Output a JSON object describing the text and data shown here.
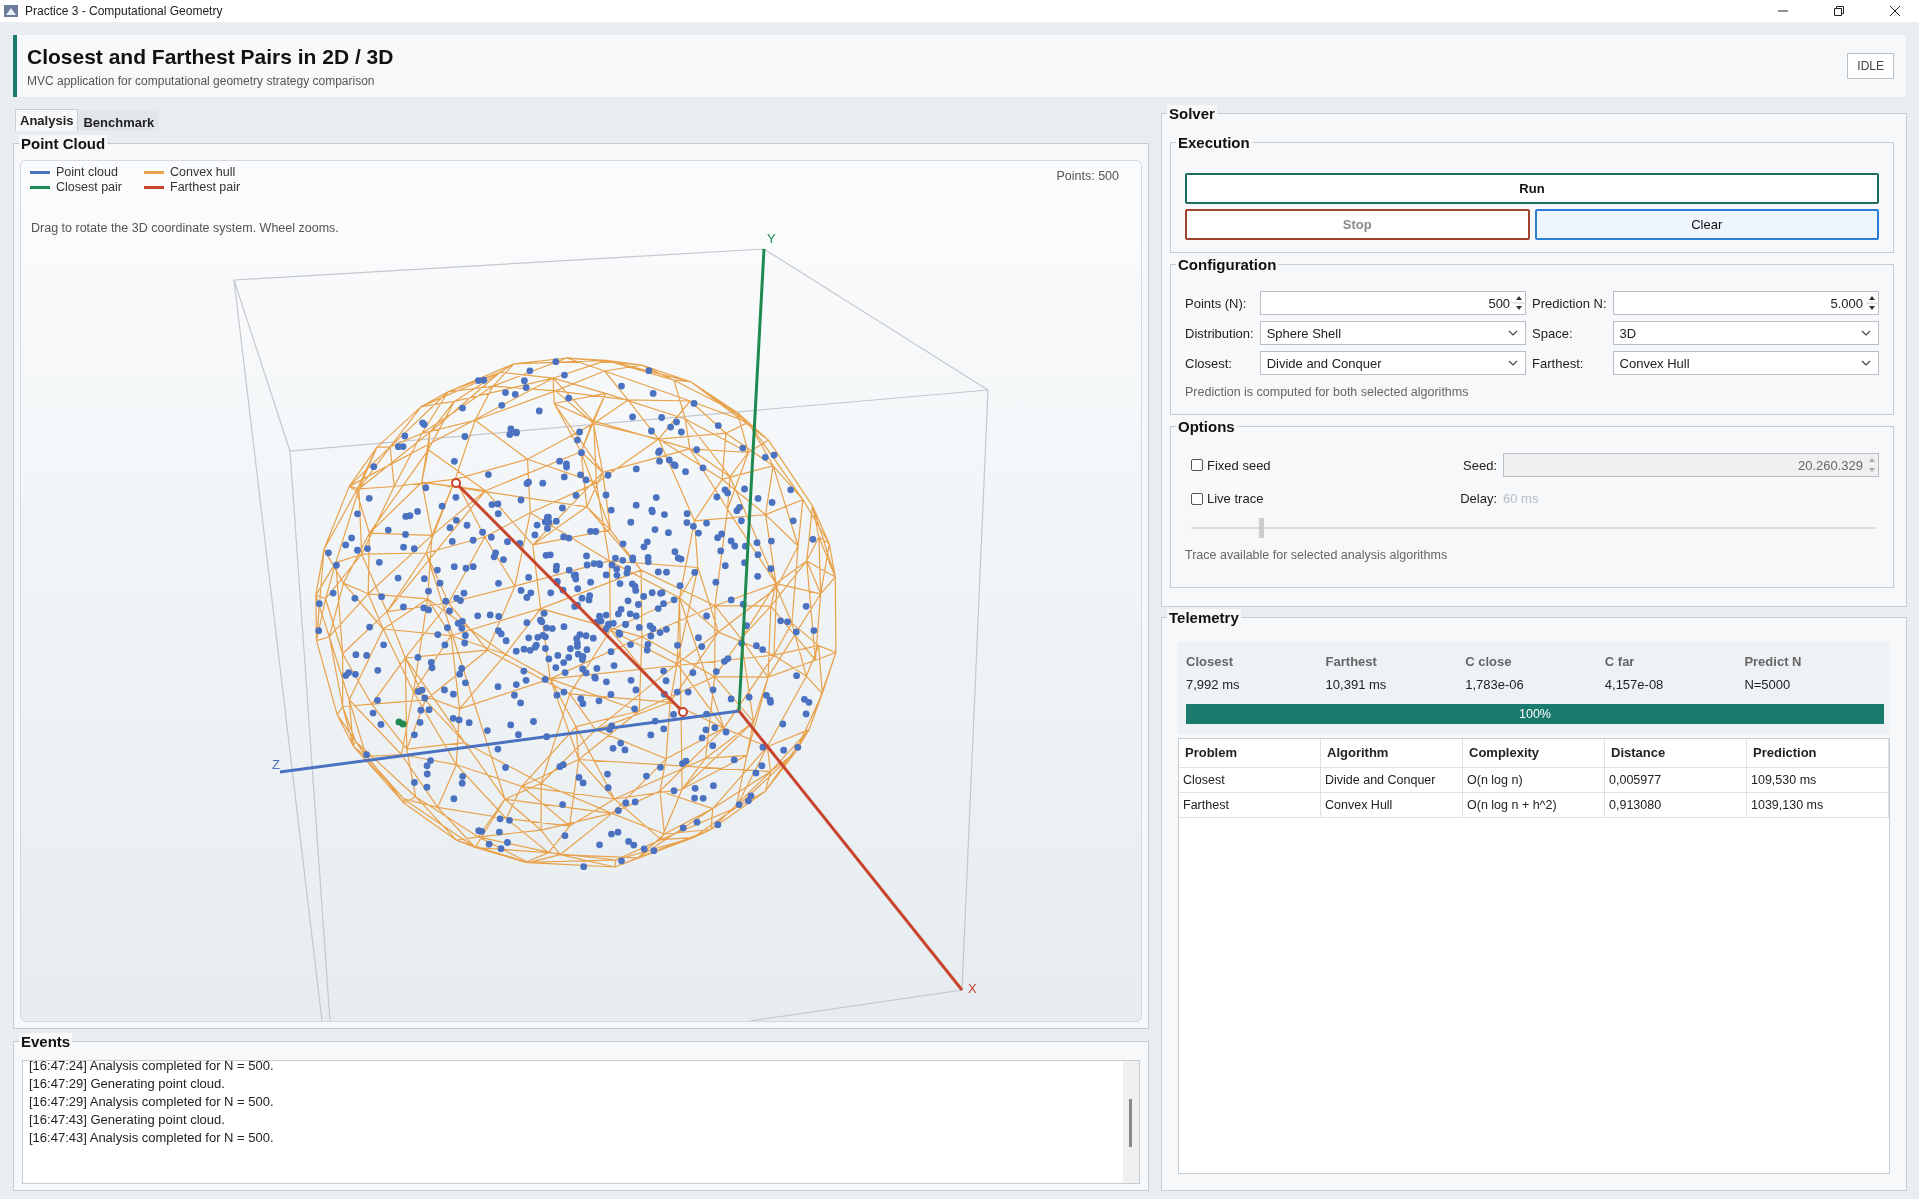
{
  "window": {
    "title": "Practice 3 - Computational Geometry"
  },
  "header": {
    "title": "Closest and Farthest Pairs in 2D / 3D",
    "subtitle": "MVC application for computational geometry strategy comparison",
    "status": "IDLE"
  },
  "tabs": [
    {
      "label": "Analysis",
      "selected": true
    },
    {
      "label": "Benchmark",
      "selected": false
    }
  ],
  "point_cloud": {
    "title": "Point Cloud",
    "count": "Points: 500",
    "hint": "Drag to rotate the 3D coordinate system. Wheel zooms.",
    "legend": [
      {
        "label": "Point cloud",
        "color": "#4a72c0"
      },
      {
        "label": "Convex hull",
        "color": "#e8a24c"
      },
      {
        "label": "Closest pair",
        "color": "#1e8a50"
      },
      {
        "label": "Farthest pair",
        "color": "#c8442c"
      }
    ],
    "axes": [
      {
        "label": "Y",
        "kind": "y"
      },
      {
        "label": "Z",
        "kind": "z"
      },
      {
        "label": "X",
        "kind": "x"
      }
    ]
  },
  "events": {
    "title": "Events",
    "lines": [
      "[16:47:24] Analysis completed for N = 500.",
      "[16:47:29] Generating point cloud.",
      "[16:47:29] Analysis completed for N = 500.",
      "[16:47:43] Generating point cloud.",
      "[16:47:43] Analysis completed for N = 500."
    ]
  },
  "solver": {
    "title": "Solver",
    "execution": {
      "title": "Execution",
      "buttons": [
        {
          "label": "Run",
          "kind": "run",
          "disabled": false
        },
        {
          "label": "Stop",
          "kind": "stop",
          "disabled": true
        },
        {
          "label": "Clear",
          "kind": "clear",
          "disabled": false
        }
      ]
    },
    "configuration": {
      "title": "Configuration",
      "note": "Prediction is computed for both selected algorithms",
      "fields": [
        {
          "label": "Points (N):",
          "value": "500",
          "kind": "spinner"
        },
        {
          "label": "Prediction N:",
          "value": "5.000",
          "kind": "spinner"
        },
        {
          "label": "Distribution:",
          "value": "Sphere Shell",
          "kind": "select"
        },
        {
          "label": "Space:",
          "value": "3D",
          "kind": "select"
        },
        {
          "label": "Closest:",
          "value": "Divide and Conquer",
          "kind": "select"
        },
        {
          "label": "Farthest:",
          "value": "Convex Hull",
          "kind": "select"
        }
      ]
    },
    "options": {
      "title": "Options",
      "fixed_seed": {
        "label": "Fixed seed",
        "checked": false
      },
      "seed": {
        "label": "Seed:",
        "value": "20.260.329",
        "disabled": true
      },
      "live_trace": {
        "label": "Live trace",
        "checked": false
      },
      "delay": {
        "label": "Delay:",
        "value": "60 ms",
        "disabled": true
      },
      "slider": {
        "level": 0.1,
        "disabled": true
      },
      "note": "Trace available for selected analysis algorithms"
    }
  },
  "telemetry": {
    "title": "Telemetry",
    "stats": [
      {
        "label": "Closest",
        "value": "7,992 ms"
      },
      {
        "label": "Farthest",
        "value": "10,391 ms"
      },
      {
        "label": "C close",
        "value": "1,783e-06"
      },
      {
        "label": "C far",
        "value": "4,157e-08"
      },
      {
        "label": "Predict N",
        "value": "N=5000"
      }
    ],
    "progress": {
      "level": 1,
      "text": "100%"
    },
    "table": {
      "columns": [
        "Problem",
        "Algorithm",
        "Complexity",
        "Distance",
        "Prediction"
      ],
      "rows": [
        [
          "Closest",
          "Divide and Conquer",
          "O(n log n)",
          "0,005977",
          "109,530 ms"
        ],
        [
          "Farthest",
          "Convex Hull",
          "O(n log n + h^2)",
          "0,913080",
          "1039,130 ms"
        ]
      ]
    }
  }
}
